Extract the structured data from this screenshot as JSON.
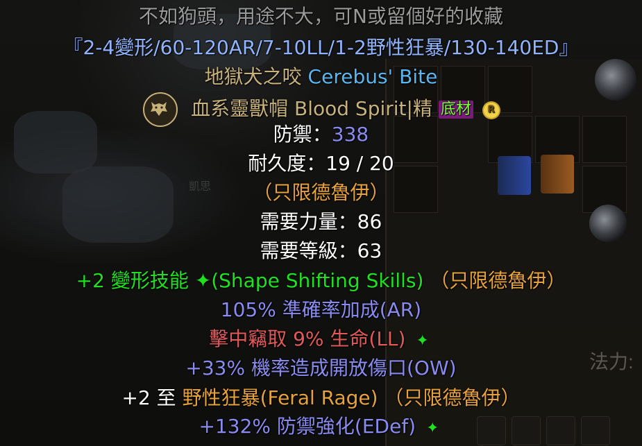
{
  "background": {
    "right_label": "法力:",
    "small_label": "凱思"
  },
  "item": {
    "note": "不如狗頭，用途不大，可N或留個好的收藏",
    "tag": "『2-4變形/60-120AR/7-10LL/1-2野性狂暴/130-140ED』",
    "name_cn": "地獄犬之咬",
    "name_en": "Cerebus' Bite",
    "base_cn": "血系靈獸帽",
    "base_en": "Blood Spirit",
    "base_sep": "|",
    "base_tier": "精",
    "base_badge": "底材",
    "rarity_badge": "R",
    "defense_label": "防禦：",
    "defense_value": "338",
    "durability": "耐久度：19 / 20",
    "class_restriction": "（只限德魯伊）",
    "req_str": "需要力量：86",
    "req_level": "需要等級：63",
    "mod_skills_value": "+2 變形技能",
    "mod_skills_en": "(Shape Shifting Skills)",
    "mod_skills_class": "（只限德魯伊）",
    "mod_ar": "105% 準確率加成(AR)",
    "mod_ll": "擊中竊取 9% 生命(LL)",
    "mod_ow": "+33% 機率造成開放傷口(OW)",
    "mod_feral_prefix": "+2 至",
    "mod_feral_skill": "野性狂暴(Feral Rage)",
    "mod_feral_class": "（只限德魯伊）",
    "mod_edef": "+132% 防禦強化(EDef)",
    "sparkle": "✦"
  },
  "colors": {
    "note": "#9a9a9a",
    "tag": "#8fb4ff",
    "unique_name": "#c8b27a",
    "magic_blue": "#8a8bf0",
    "green": "#1fe21f",
    "class_orange": "#e8a23a",
    "red": "#e05a5a"
  },
  "icons": {
    "class_icon": "wolf-head-icon",
    "sparkle_icon": "sparkle-icon"
  }
}
